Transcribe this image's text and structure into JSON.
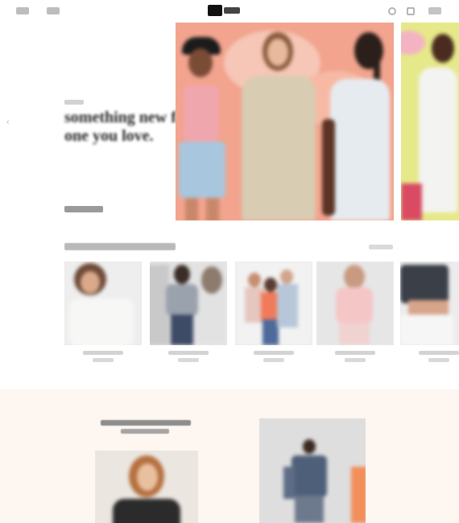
{
  "header": {
    "logo_icon": "brand-logo-icon",
    "icons": [
      "search-icon",
      "account-icon",
      "bag-icon"
    ]
  },
  "hero": {
    "title": "something new for the one you love.",
    "main_bg": "#f2a48e",
    "side_bg": "#e6e98a"
  },
  "colors": {
    "lower_bg": "#fdf6f1"
  }
}
